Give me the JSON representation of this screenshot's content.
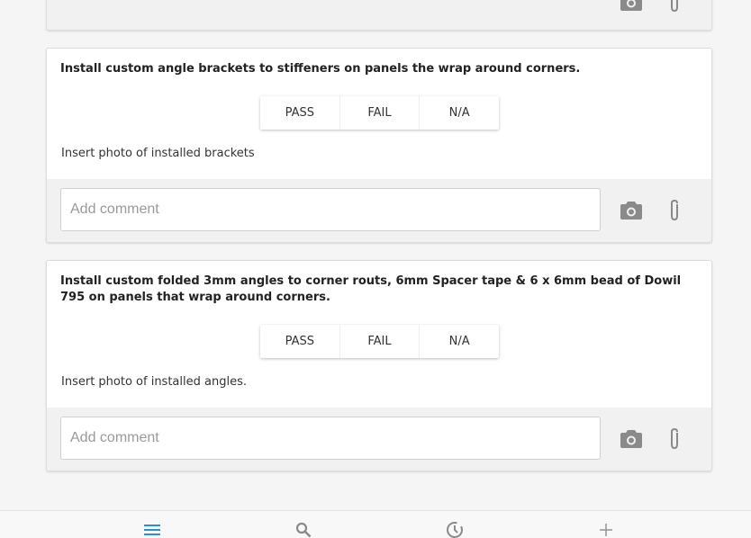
{
  "items": [
    {
      "question": "",
      "comment_placeholder": "Add comment"
    },
    {
      "question": "Install custom angle brackets to stiffeners on panels the wrap around corners.",
      "choices": [
        "PASS",
        "FAIL",
        "N/A"
      ],
      "instruction": "Insert photo of installed brackets",
      "comment_placeholder": "Add comment"
    },
    {
      "question": "Install custom folded 3mm angles to corner routs, 6mm Spacer tape & 6 x 6mm bead of Dowil 795 on panels that wrap around corners.",
      "choices": [
        "PASS",
        "FAIL",
        "N/A"
      ],
      "instruction": "Insert photo of installed angles.",
      "comment_placeholder": "Add comment"
    }
  ],
  "icons": {
    "camera": "camera-icon",
    "attach": "paperclip-icon"
  },
  "bottom_nav": [
    {
      "icon": "menu-icon",
      "active": true
    },
    {
      "icon": "search-icon",
      "active": false
    },
    {
      "icon": "history-icon",
      "active": false
    },
    {
      "icon": "plus-icon",
      "active": false
    }
  ],
  "colors": {
    "accent": "#2b8fd6",
    "icon_gray": "#8a8a8a",
    "background": "#f5f5f5"
  }
}
